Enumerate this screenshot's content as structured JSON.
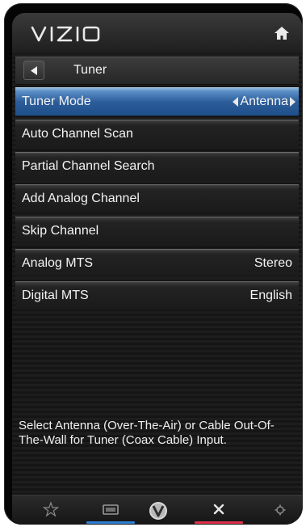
{
  "header": {
    "brand": "VIZIO",
    "home_icon": "home-icon"
  },
  "nav": {
    "back_icon": "back-arrow-icon",
    "title": "Tuner"
  },
  "menu": [
    {
      "label": "Tuner Mode",
      "value": "Antenna",
      "selected": true,
      "selector": true
    },
    {
      "label": "Auto Channel Scan",
      "value": ""
    },
    {
      "label": "Partial Channel Search",
      "value": ""
    },
    {
      "label": "Add Analog Channel",
      "value": ""
    },
    {
      "label": "Skip Channel",
      "value": ""
    },
    {
      "label": "Analog MTS",
      "value": "Stereo"
    },
    {
      "label": "Digital MTS",
      "value": "English"
    }
  ],
  "help": {
    "text": "Select Antenna (Over-The-Air) or Cable Out-Of-The-Wall for Tuner (Coax Cable) Input."
  },
  "bottom_bar": {
    "items": [
      {
        "icon": "star-icon"
      },
      {
        "icon": "widescreen-icon",
        "accent": "#2f7fd6"
      },
      {
        "icon": "vizio-v-icon"
      },
      {
        "icon": "close-icon",
        "accent": "#e0304a"
      },
      {
        "icon": "gear-icon"
      }
    ]
  },
  "colors": {
    "selected_row": "#2c5d9a",
    "text": "#f4f4f4",
    "background": "#151515"
  }
}
